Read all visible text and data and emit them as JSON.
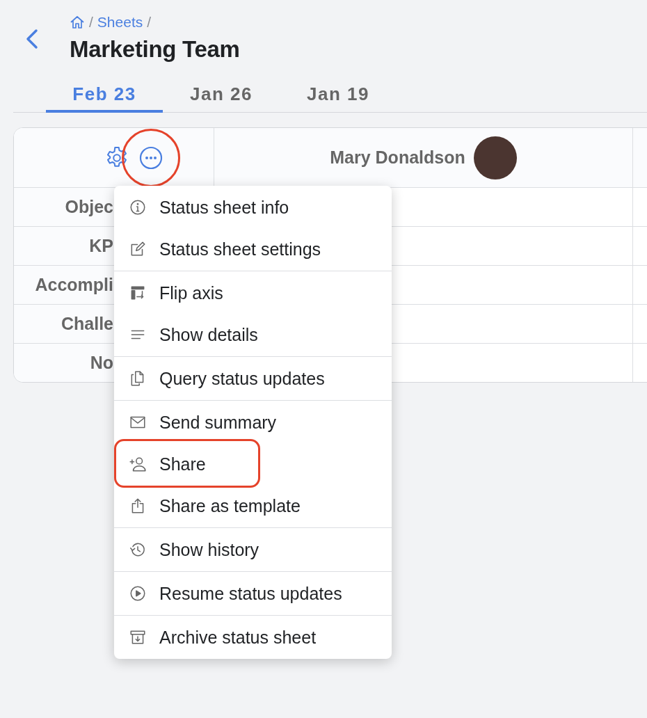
{
  "breadcrumb": [
    {
      "kind": "home"
    },
    {
      "kind": "separator",
      "text": "/"
    },
    {
      "kind": "link",
      "text": "Sheets"
    },
    {
      "kind": "separator",
      "text": "/"
    }
  ],
  "title": "Marketing Team",
  "tabs": [
    {
      "label": "Feb 23",
      "selected": true
    },
    {
      "label": "Jan 26",
      "selected": false
    },
    {
      "label": "Jan 19",
      "selected": false
    }
  ],
  "table": {
    "header_tools": {
      "more_highlighted": true
    },
    "columns": [
      {
        "name": "Mary Donaldson",
        "avatar": true
      }
    ],
    "rows": [
      "Objec",
      "KP",
      "Accompli",
      "Challe",
      "No"
    ]
  },
  "menu": {
    "groups": [
      [
        {
          "kind": "info",
          "label": "Status sheet info",
          "highlighted": false
        },
        {
          "kind": "edit",
          "label": "Status sheet settings",
          "highlighted": false
        }
      ],
      [
        {
          "kind": "flip",
          "label": "Flip axis",
          "highlighted": false
        },
        {
          "kind": "lines",
          "label": "Show details",
          "highlighted": false
        }
      ],
      [
        {
          "kind": "copy",
          "label": "Query status updates",
          "highlighted": false
        }
      ],
      [
        {
          "kind": "mail",
          "label": "Send summary",
          "highlighted": false
        },
        {
          "kind": "adduser",
          "label": "Share",
          "highlighted": true
        },
        {
          "kind": "upload",
          "label": "Share as template",
          "highlighted": false
        }
      ],
      [
        {
          "kind": "history",
          "label": "Show history",
          "highlighted": false
        }
      ],
      [
        {
          "kind": "play",
          "label": "Resume status updates",
          "highlighted": false
        }
      ],
      [
        {
          "kind": "archive",
          "label": "Archive status sheet",
          "highlighted": false
        }
      ]
    ]
  }
}
